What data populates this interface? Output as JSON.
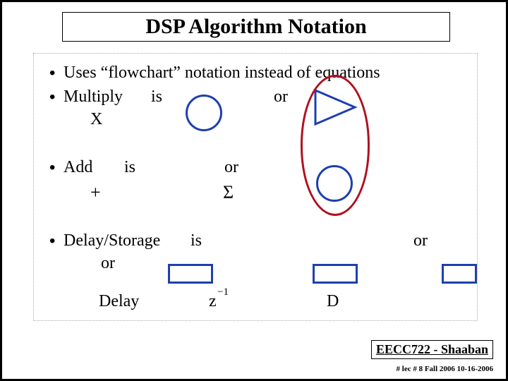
{
  "title": "DSP Algorithm Notation",
  "bullets": {
    "b1": "Uses “flowchart” notation instead of equations",
    "b2": "Multiply",
    "b2_is": "is",
    "b2_or": "or",
    "b2_sym": "X",
    "b3": "Add",
    "b3_is": "is",
    "b3_or": "or",
    "b3_sym": "+",
    "b3_sigma": "Σ",
    "b4": "Delay/Storage",
    "b4_is": "is",
    "b4_or1": "or",
    "b4_or2": "or",
    "b4_delay": "Delay",
    "b4_z": "z",
    "b4_exp": "−1",
    "b4_D": "D"
  },
  "footer": {
    "course": "EECC722 - Shaaban",
    "meta": "#  lec # 8    Fall 2006    10-16-2006"
  }
}
